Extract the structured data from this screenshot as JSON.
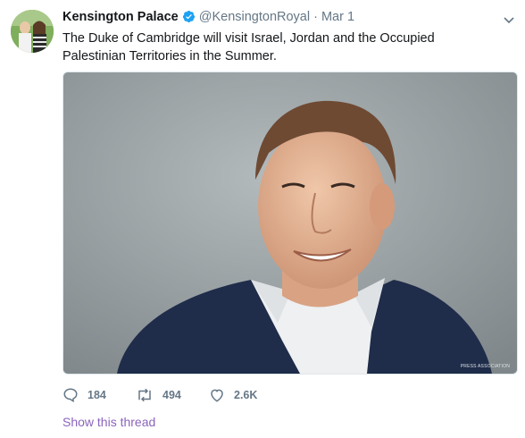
{
  "tweet": {
    "display_name": "Kensington Palace",
    "handle": "@KensingtonRoyal",
    "separator": "·",
    "date": "Mar 1",
    "text": "The Duke of Cambridge will visit Israel, Jordan and the Occupied Palestinian Territories in the Summer.",
    "media_credit": "PRESS ASSOCIATION",
    "actions": {
      "reply_count": "184",
      "retweet_count": "494",
      "like_count": "2.6K"
    },
    "show_thread_label": "Show this thread"
  },
  "colors": {
    "verified": "#1da1f2",
    "secondary_text": "#657786",
    "thread_link": "#8a64bd"
  },
  "icons": {
    "verified": "verified-badge-icon",
    "caret": "chevron-down-icon",
    "reply": "reply-icon",
    "retweet": "retweet-icon",
    "like": "heart-icon"
  }
}
